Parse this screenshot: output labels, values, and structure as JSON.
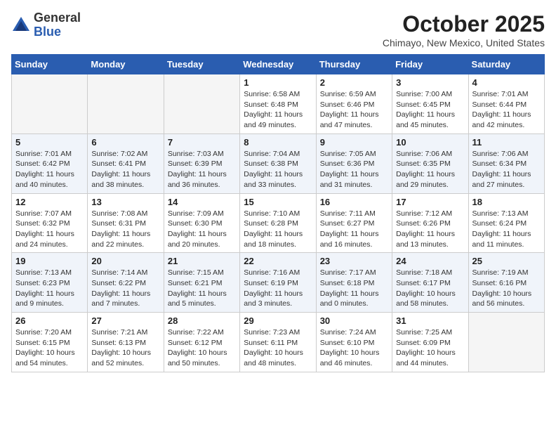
{
  "header": {
    "logo_general": "General",
    "logo_blue": "Blue",
    "month_title": "October 2025",
    "location": "Chimayo, New Mexico, United States"
  },
  "weekdays": [
    "Sunday",
    "Monday",
    "Tuesday",
    "Wednesday",
    "Thursday",
    "Friday",
    "Saturday"
  ],
  "weeks": [
    [
      {
        "day": "",
        "info": ""
      },
      {
        "day": "",
        "info": ""
      },
      {
        "day": "",
        "info": ""
      },
      {
        "day": "1",
        "info": "Sunrise: 6:58 AM\nSunset: 6:48 PM\nDaylight: 11 hours\nand 49 minutes."
      },
      {
        "day": "2",
        "info": "Sunrise: 6:59 AM\nSunset: 6:46 PM\nDaylight: 11 hours\nand 47 minutes."
      },
      {
        "day": "3",
        "info": "Sunrise: 7:00 AM\nSunset: 6:45 PM\nDaylight: 11 hours\nand 45 minutes."
      },
      {
        "day": "4",
        "info": "Sunrise: 7:01 AM\nSunset: 6:44 PM\nDaylight: 11 hours\nand 42 minutes."
      }
    ],
    [
      {
        "day": "5",
        "info": "Sunrise: 7:01 AM\nSunset: 6:42 PM\nDaylight: 11 hours\nand 40 minutes."
      },
      {
        "day": "6",
        "info": "Sunrise: 7:02 AM\nSunset: 6:41 PM\nDaylight: 11 hours\nand 38 minutes."
      },
      {
        "day": "7",
        "info": "Sunrise: 7:03 AM\nSunset: 6:39 PM\nDaylight: 11 hours\nand 36 minutes."
      },
      {
        "day": "8",
        "info": "Sunrise: 7:04 AM\nSunset: 6:38 PM\nDaylight: 11 hours\nand 33 minutes."
      },
      {
        "day": "9",
        "info": "Sunrise: 7:05 AM\nSunset: 6:36 PM\nDaylight: 11 hours\nand 31 minutes."
      },
      {
        "day": "10",
        "info": "Sunrise: 7:06 AM\nSunset: 6:35 PM\nDaylight: 11 hours\nand 29 minutes."
      },
      {
        "day": "11",
        "info": "Sunrise: 7:06 AM\nSunset: 6:34 PM\nDaylight: 11 hours\nand 27 minutes."
      }
    ],
    [
      {
        "day": "12",
        "info": "Sunrise: 7:07 AM\nSunset: 6:32 PM\nDaylight: 11 hours\nand 24 minutes."
      },
      {
        "day": "13",
        "info": "Sunrise: 7:08 AM\nSunset: 6:31 PM\nDaylight: 11 hours\nand 22 minutes."
      },
      {
        "day": "14",
        "info": "Sunrise: 7:09 AM\nSunset: 6:30 PM\nDaylight: 11 hours\nand 20 minutes."
      },
      {
        "day": "15",
        "info": "Sunrise: 7:10 AM\nSunset: 6:28 PM\nDaylight: 11 hours\nand 18 minutes."
      },
      {
        "day": "16",
        "info": "Sunrise: 7:11 AM\nSunset: 6:27 PM\nDaylight: 11 hours\nand 16 minutes."
      },
      {
        "day": "17",
        "info": "Sunrise: 7:12 AM\nSunset: 6:26 PM\nDaylight: 11 hours\nand 13 minutes."
      },
      {
        "day": "18",
        "info": "Sunrise: 7:13 AM\nSunset: 6:24 PM\nDaylight: 11 hours\nand 11 minutes."
      }
    ],
    [
      {
        "day": "19",
        "info": "Sunrise: 7:13 AM\nSunset: 6:23 PM\nDaylight: 11 hours\nand 9 minutes."
      },
      {
        "day": "20",
        "info": "Sunrise: 7:14 AM\nSunset: 6:22 PM\nDaylight: 11 hours\nand 7 minutes."
      },
      {
        "day": "21",
        "info": "Sunrise: 7:15 AM\nSunset: 6:21 PM\nDaylight: 11 hours\nand 5 minutes."
      },
      {
        "day": "22",
        "info": "Sunrise: 7:16 AM\nSunset: 6:19 PM\nDaylight: 11 hours\nand 3 minutes."
      },
      {
        "day": "23",
        "info": "Sunrise: 7:17 AM\nSunset: 6:18 PM\nDaylight: 11 hours\nand 0 minutes."
      },
      {
        "day": "24",
        "info": "Sunrise: 7:18 AM\nSunset: 6:17 PM\nDaylight: 10 hours\nand 58 minutes."
      },
      {
        "day": "25",
        "info": "Sunrise: 7:19 AM\nSunset: 6:16 PM\nDaylight: 10 hours\nand 56 minutes."
      }
    ],
    [
      {
        "day": "26",
        "info": "Sunrise: 7:20 AM\nSunset: 6:15 PM\nDaylight: 10 hours\nand 54 minutes."
      },
      {
        "day": "27",
        "info": "Sunrise: 7:21 AM\nSunset: 6:13 PM\nDaylight: 10 hours\nand 52 minutes."
      },
      {
        "day": "28",
        "info": "Sunrise: 7:22 AM\nSunset: 6:12 PM\nDaylight: 10 hours\nand 50 minutes."
      },
      {
        "day": "29",
        "info": "Sunrise: 7:23 AM\nSunset: 6:11 PM\nDaylight: 10 hours\nand 48 minutes."
      },
      {
        "day": "30",
        "info": "Sunrise: 7:24 AM\nSunset: 6:10 PM\nDaylight: 10 hours\nand 46 minutes."
      },
      {
        "day": "31",
        "info": "Sunrise: 7:25 AM\nSunset: 6:09 PM\nDaylight: 10 hours\nand 44 minutes."
      },
      {
        "day": "",
        "info": ""
      }
    ]
  ]
}
